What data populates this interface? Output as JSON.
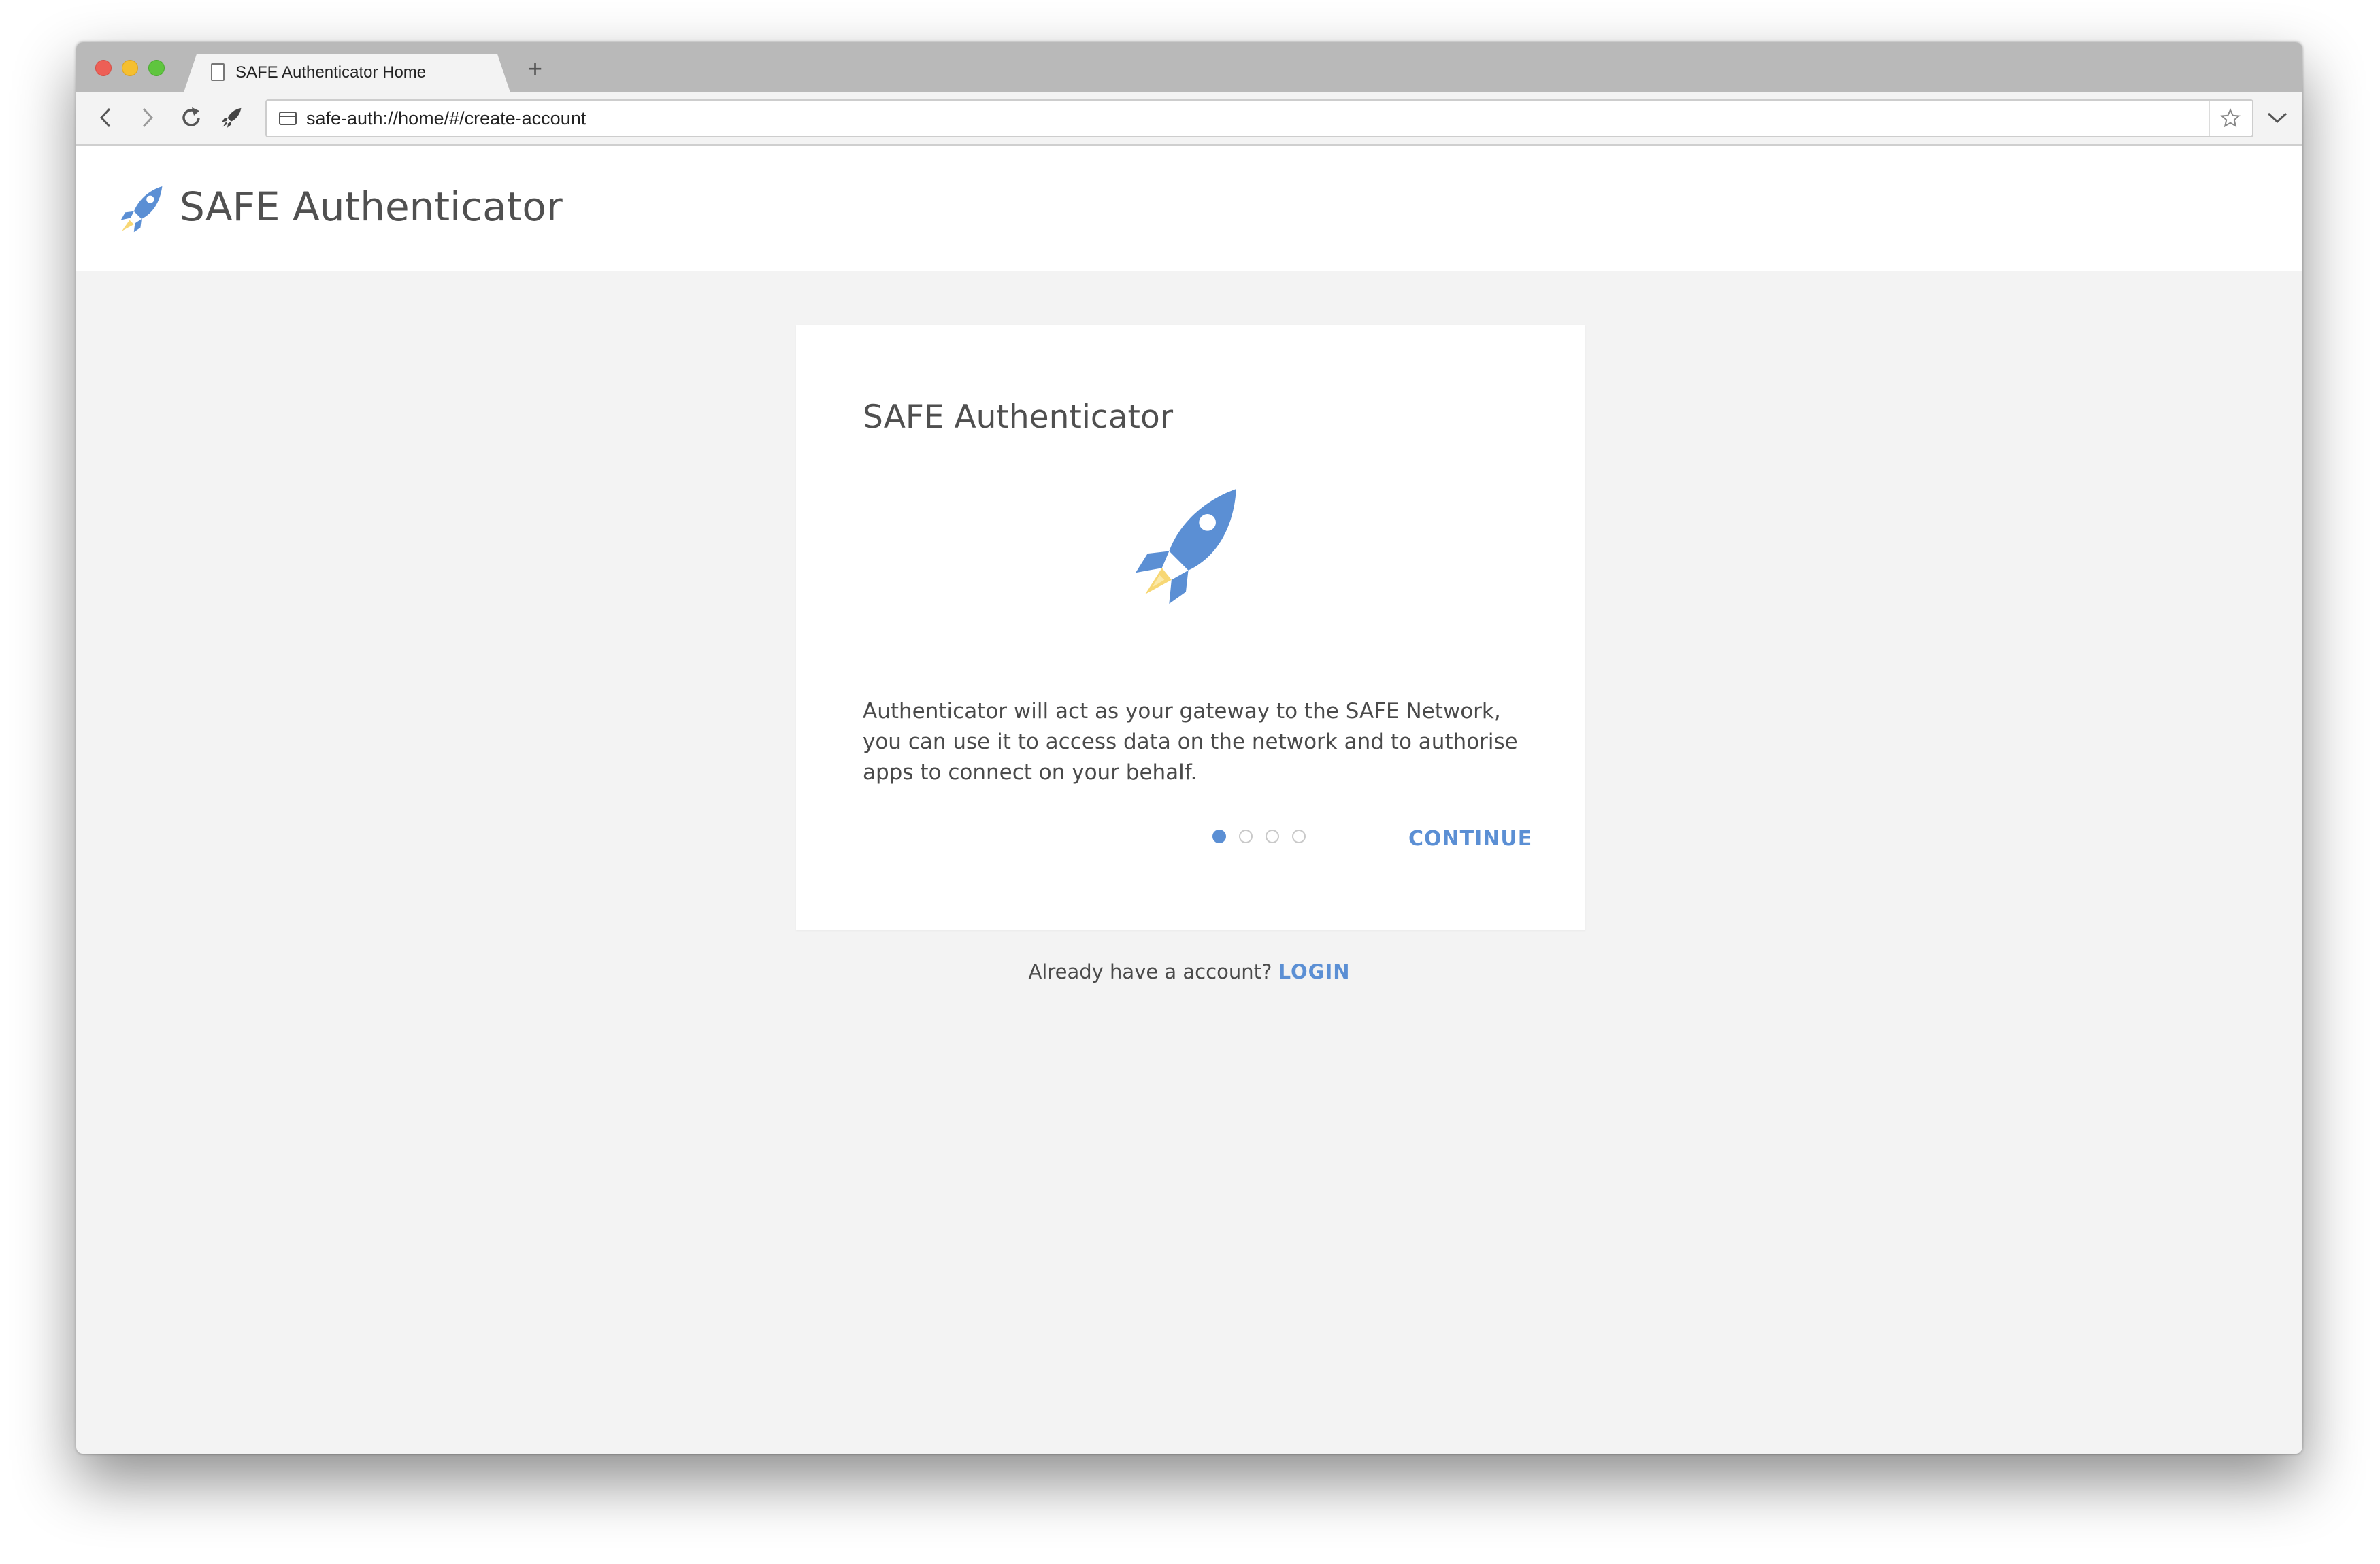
{
  "browser": {
    "tab_title": "SAFE Authenticator Home",
    "new_tab_label": "+",
    "url": "safe-auth://home/#/create-account"
  },
  "header": {
    "title": "SAFE Authenticator"
  },
  "card": {
    "title": "SAFE Authenticator",
    "description": "Authenticator will act as your gateway to the SAFE Network, you can use it to access data on the network and to authorise apps to connect on your behalf.",
    "steps_total": 4,
    "current_step": 1,
    "continue_label": "CONTINUE"
  },
  "footer": {
    "prompt": "Already have a account? ",
    "login_label": "LOGIN"
  },
  "colors": {
    "accent": "#5b8fd4",
    "flame": "#f7d774",
    "page_bg": "#f3f3f3"
  },
  "icons": {
    "logo": "rocket-icon",
    "back": "chevron-left-icon",
    "forward": "chevron-right-icon",
    "reload": "reload-icon",
    "extension": "rocket-icon",
    "bookmark": "star-icon",
    "menu": "chevron-down-icon"
  }
}
